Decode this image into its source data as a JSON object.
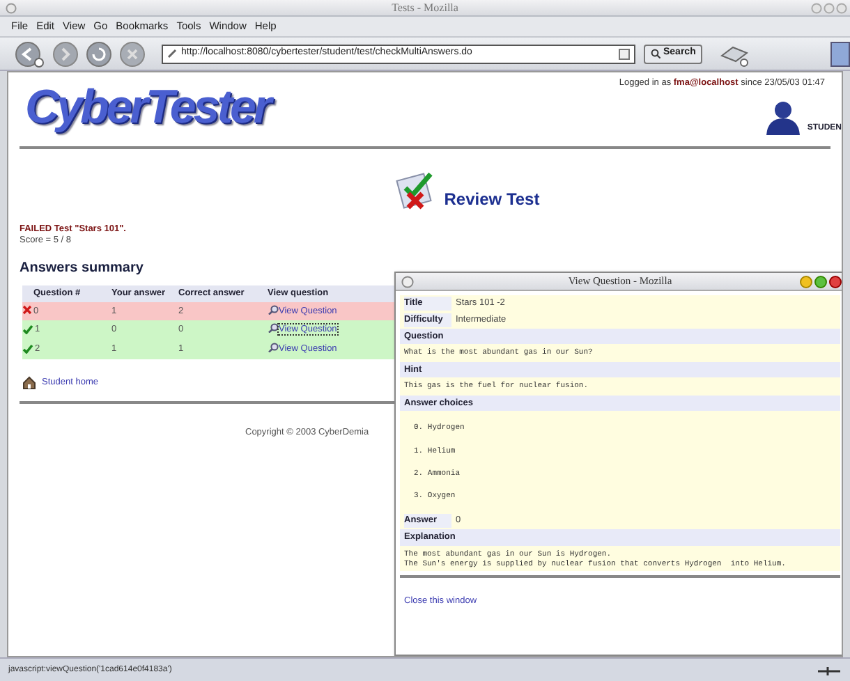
{
  "window": {
    "title": "Tests - Mozilla"
  },
  "menu": [
    "File",
    "Edit",
    "View",
    "Go",
    "Bookmarks",
    "Tools",
    "Window",
    "Help"
  ],
  "address_bar": {
    "value": "http://localhost:8080/cybertester/student/test/checkMultiAnswers.do"
  },
  "search_button": "Search",
  "page": {
    "logo": "CyberTester",
    "login_prefix": "Logged in as",
    "login_user": "fma@localhost",
    "login_suffix": "since 23/05/03 01:47",
    "role": "STUDEN",
    "heading": "Review Test",
    "result": "FAILED Test \"Stars 101\".",
    "score": "Score = 5 / 8",
    "summary_title": "Answers summary",
    "columns": [
      "Question #",
      "Your answer",
      "Correct answer",
      "View question"
    ],
    "rows": [
      {
        "correct": false,
        "question": "0",
        "your_answer": "1",
        "correct_answer": "2",
        "link": "View Question",
        "focused": false
      },
      {
        "correct": true,
        "question": "1",
        "your_answer": "0",
        "correct_answer": "0",
        "link": "View Question",
        "focused": true
      },
      {
        "correct": true,
        "question": "2",
        "your_answer": "1",
        "correct_answer": "1",
        "link": "View Question",
        "focused": false
      }
    ],
    "home_link": "Student home",
    "copyright": "Copyright © 2003 CyberDemia"
  },
  "popup": {
    "title": "View Question - Mozilla",
    "pairs": [
      {
        "label": "Title",
        "value": "Stars 101 -2"
      },
      {
        "label": "Difficulty",
        "value": "Intermediate"
      }
    ],
    "question_label": "Question",
    "question": "What is the most abundant gas in our Sun?",
    "hint_label": "Hint",
    "hint": "This gas is the fuel for nuclear fusion.",
    "choices_label": "Answer choices",
    "choices": [
      "0. Hydrogen",
      "1. Helium",
      "2. Ammonia",
      "3. Oxygen"
    ],
    "answer_label": "Answer",
    "answer": "0",
    "explanation_label": "Explanation",
    "explanation": [
      "The most abundant gas in our Sun is Hydrogen.",
      "The Sun's energy is supplied by nuclear fusion that converts Hydrogen  into Helium."
    ],
    "close_link": "Close this window"
  },
  "status_bar": "javascript:viewQuestion('1cad614e0f4183a')"
}
